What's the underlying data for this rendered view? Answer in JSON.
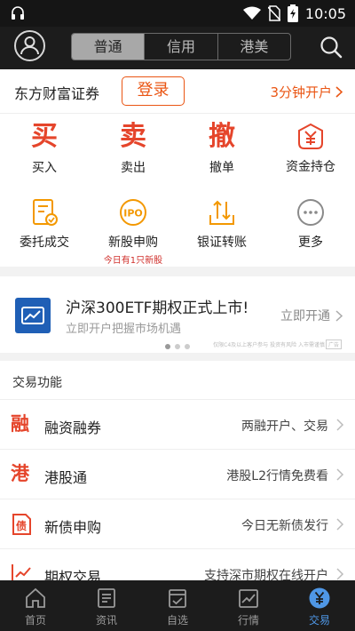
{
  "status": {
    "time": "10:05"
  },
  "topbar": {
    "segments": [
      "普通",
      "信用",
      "港美"
    ],
    "active_segment": 0
  },
  "login": {
    "brand": "东方财富证券",
    "login_label": "登录",
    "open_account": "3分钟开户"
  },
  "grid": {
    "items": [
      {
        "icon_char": "买",
        "label": "买入"
      },
      {
        "icon_char": "卖",
        "label": "卖出"
      },
      {
        "icon_char": "撤",
        "label": "撤单"
      },
      {
        "icon": "yuan-shield-icon",
        "label": "资金持仓"
      },
      {
        "icon": "document-check-icon",
        "label": "委托成交"
      },
      {
        "icon": "ipo-icon",
        "label": "新股申购",
        "sub": "今日有1只新股"
      },
      {
        "icon": "transfer-icon",
        "label": "银证转账"
      },
      {
        "icon": "more-icon",
        "label": "更多"
      }
    ]
  },
  "banner": {
    "title": "沪深300ETF期权正式上市!",
    "subtitle": "立即开户把握市场机遇",
    "action": "立即开通",
    "fine_print": "仅限C4及以上客户参与 投资有风险 入市需谨慎",
    "ad_tag": "广告",
    "dots": 3,
    "active_dot": 0
  },
  "section": {
    "title": "交易功能"
  },
  "functions": [
    {
      "icon_char": "融",
      "label": "融资融券",
      "desc": "两融开户、交易"
    },
    {
      "icon_char": "港",
      "label": "港股通",
      "desc": "港股L2行情免费看"
    },
    {
      "icon": "bond-icon",
      "label": "新债申购",
      "desc": "今日无新债发行"
    },
    {
      "icon": "options-icon",
      "label": "期权交易",
      "desc": "支持深市期权在线开户"
    }
  ],
  "tabbar": {
    "tabs": [
      {
        "label": "首页",
        "icon": "home-icon"
      },
      {
        "label": "资讯",
        "icon": "news-icon"
      },
      {
        "label": "自选",
        "icon": "watchlist-icon"
      },
      {
        "label": "行情",
        "icon": "market-icon"
      },
      {
        "label": "交易",
        "icon": "trade-yuan-icon"
      }
    ],
    "active_tab": 4
  },
  "colors": {
    "accent": "#e5452b",
    "orange": "#ea5513",
    "blue": "#4f97e6",
    "dark": "#1c1c1c"
  }
}
